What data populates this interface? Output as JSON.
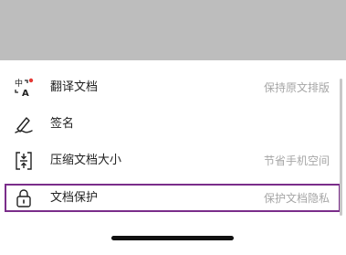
{
  "menu": {
    "items": [
      {
        "id": "translate",
        "label": "翻译文档",
        "hint": "保持原文排版",
        "icon": "translate-icon"
      },
      {
        "id": "sign",
        "label": "签名",
        "hint": "",
        "icon": "signature-pen-icon"
      },
      {
        "id": "compress",
        "label": "压缩文档大小",
        "hint": "节省手机空间",
        "icon": "compress-icon"
      },
      {
        "id": "protect",
        "label": "文档保护",
        "hint": "保护文档隐私",
        "icon": "lock-icon"
      }
    ]
  },
  "colors": {
    "overlay": "#bdbdbd",
    "highlight_border": "#7a2d8a",
    "badge_dot": "#e53935"
  }
}
